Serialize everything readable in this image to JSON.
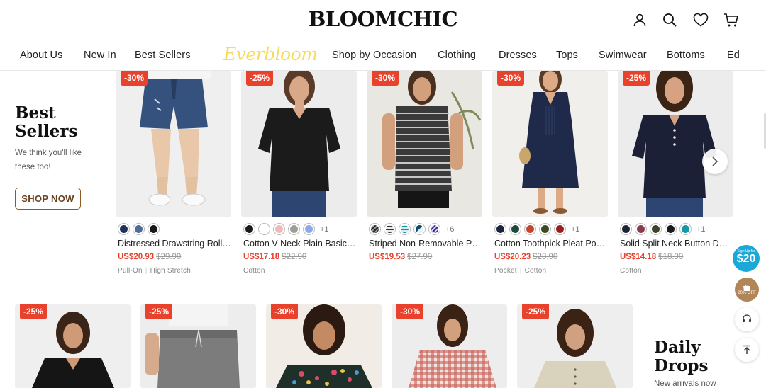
{
  "header": {
    "logo": "BLOOMCHIC",
    "nav": [
      "About Us",
      "New In",
      "Best Sellers",
      "Shop by Occasion",
      "Clothing",
      "Dresses",
      "Tops",
      "Swimwear",
      "Bottoms",
      "Ed"
    ],
    "everbloom": "Everbloom",
    "icons": [
      "account-icon",
      "search-icon",
      "wishlist-heart-icon",
      "cart-icon"
    ]
  },
  "promo": {
    "title_line1": "Best",
    "title_line2": "Sellers",
    "subtitle": "We think you'll like these too!",
    "button": "SHOP NOW"
  },
  "products": [
    {
      "badge": "-30%",
      "name": "Distressed Drawstring Roll Hem Denim Shorts",
      "price": "US$20.93",
      "old_price": "$29.90",
      "tags": [
        "Pull-On",
        "High Stretch"
      ],
      "swatches": [
        "#1e3359",
        "#506a9a",
        "#1a1a1a"
      ],
      "more": ""
    },
    {
      "badge": "-25%",
      "name": "Cotton V Neck Plain Basic T-shirt",
      "price": "US$17.18",
      "old_price": "$22.90",
      "tags": [
        "Cotton"
      ],
      "swatches": [
        "#1a1a1a",
        "#ffffff",
        "#f2b8b8",
        "#9e9e94",
        "#8ea9e8"
      ],
      "more": "+1"
    },
    {
      "badge": "-30%",
      "name": "Striped Non-Removable Padding Tankini Top",
      "price": "US$19.53",
      "old_price": "$27.90",
      "tags": [],
      "swatches": [
        "#444444",
        "#d6d6d6",
        "#1aa0b4",
        "#0e4d72",
        "#3a2e8a"
      ],
      "more": "+6"
    },
    {
      "badge": "-30%",
      "name": "Cotton Toothpick Pleat Pocket Midi Dress",
      "price": "US$20.23",
      "old_price": "$28.90",
      "tags": [
        "Pocket",
        "Cotton"
      ],
      "swatches": [
        "#1c2540",
        "#1f4a3b",
        "#c4442e",
        "#3c4a22",
        "#9a1c1c"
      ],
      "more": "+1"
    },
    {
      "badge": "-25%",
      "name": "Solid Split Neck Button Detail Blouse",
      "price": "US$14.18",
      "old_price": "$18.90",
      "tags": [
        "Cotton"
      ],
      "swatches": [
        "#1c2238",
        "#8a3b4e",
        "#3b4628",
        "#1a1a1a",
        "#0e9aa6"
      ],
      "more": "+1"
    }
  ],
  "row2": {
    "badges": [
      "-25%",
      "-25%",
      "-30%",
      "-30%",
      "-25%"
    ],
    "title_line1": "Daily",
    "title_line2": "Drops",
    "subtitle": "New arrivals now"
  },
  "floating": {
    "signup_small": "Sign Up for",
    "signup_amount": "$20",
    "coupon": "20% OFF"
  },
  "colors": {
    "sale_red": "#e8412c",
    "brand_brown": "#8a5a2b",
    "everbloom_yellow": "#f6dc5e",
    "signup_blue": "#1ba8d6"
  }
}
